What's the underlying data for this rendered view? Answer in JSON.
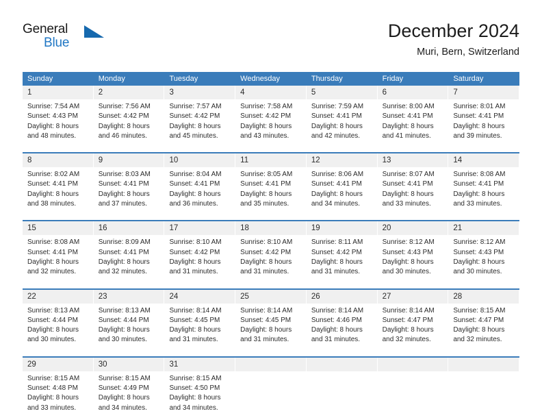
{
  "logo": {
    "primary_text": "General",
    "secondary_text": "Blue",
    "primary_color": "#1a1a1a",
    "secondary_color": "#2077c4",
    "triangle_color": "#1669ae"
  },
  "header": {
    "title": "December 2024",
    "subtitle": "Muri, Bern, Switzerland"
  },
  "theme": {
    "header_row_bg": "#3a7cba",
    "day_number_bg": "#f0f0f0",
    "text_color": "#2b2b2b"
  },
  "calendar": {
    "weekdays": [
      "Sunday",
      "Monday",
      "Tuesday",
      "Wednesday",
      "Thursday",
      "Friday",
      "Saturday"
    ],
    "weeks": [
      [
        {
          "day": "1",
          "sunrise": "Sunrise: 7:54 AM",
          "sunset": "Sunset: 4:43 PM",
          "daylight1": "Daylight: 8 hours",
          "daylight2": "and 48 minutes."
        },
        {
          "day": "2",
          "sunrise": "Sunrise: 7:56 AM",
          "sunset": "Sunset: 4:42 PM",
          "daylight1": "Daylight: 8 hours",
          "daylight2": "and 46 minutes."
        },
        {
          "day": "3",
          "sunrise": "Sunrise: 7:57 AM",
          "sunset": "Sunset: 4:42 PM",
          "daylight1": "Daylight: 8 hours",
          "daylight2": "and 45 minutes."
        },
        {
          "day": "4",
          "sunrise": "Sunrise: 7:58 AM",
          "sunset": "Sunset: 4:42 PM",
          "daylight1": "Daylight: 8 hours",
          "daylight2": "and 43 minutes."
        },
        {
          "day": "5",
          "sunrise": "Sunrise: 7:59 AM",
          "sunset": "Sunset: 4:41 PM",
          "daylight1": "Daylight: 8 hours",
          "daylight2": "and 42 minutes."
        },
        {
          "day": "6",
          "sunrise": "Sunrise: 8:00 AM",
          "sunset": "Sunset: 4:41 PM",
          "daylight1": "Daylight: 8 hours",
          "daylight2": "and 41 minutes."
        },
        {
          "day": "7",
          "sunrise": "Sunrise: 8:01 AM",
          "sunset": "Sunset: 4:41 PM",
          "daylight1": "Daylight: 8 hours",
          "daylight2": "and 39 minutes."
        }
      ],
      [
        {
          "day": "8",
          "sunrise": "Sunrise: 8:02 AM",
          "sunset": "Sunset: 4:41 PM",
          "daylight1": "Daylight: 8 hours",
          "daylight2": "and 38 minutes."
        },
        {
          "day": "9",
          "sunrise": "Sunrise: 8:03 AM",
          "sunset": "Sunset: 4:41 PM",
          "daylight1": "Daylight: 8 hours",
          "daylight2": "and 37 minutes."
        },
        {
          "day": "10",
          "sunrise": "Sunrise: 8:04 AM",
          "sunset": "Sunset: 4:41 PM",
          "daylight1": "Daylight: 8 hours",
          "daylight2": "and 36 minutes."
        },
        {
          "day": "11",
          "sunrise": "Sunrise: 8:05 AM",
          "sunset": "Sunset: 4:41 PM",
          "daylight1": "Daylight: 8 hours",
          "daylight2": "and 35 minutes."
        },
        {
          "day": "12",
          "sunrise": "Sunrise: 8:06 AM",
          "sunset": "Sunset: 4:41 PM",
          "daylight1": "Daylight: 8 hours",
          "daylight2": "and 34 minutes."
        },
        {
          "day": "13",
          "sunrise": "Sunrise: 8:07 AM",
          "sunset": "Sunset: 4:41 PM",
          "daylight1": "Daylight: 8 hours",
          "daylight2": "and 33 minutes."
        },
        {
          "day": "14",
          "sunrise": "Sunrise: 8:08 AM",
          "sunset": "Sunset: 4:41 PM",
          "daylight1": "Daylight: 8 hours",
          "daylight2": "and 33 minutes."
        }
      ],
      [
        {
          "day": "15",
          "sunrise": "Sunrise: 8:08 AM",
          "sunset": "Sunset: 4:41 PM",
          "daylight1": "Daylight: 8 hours",
          "daylight2": "and 32 minutes."
        },
        {
          "day": "16",
          "sunrise": "Sunrise: 8:09 AM",
          "sunset": "Sunset: 4:41 PM",
          "daylight1": "Daylight: 8 hours",
          "daylight2": "and 32 minutes."
        },
        {
          "day": "17",
          "sunrise": "Sunrise: 8:10 AM",
          "sunset": "Sunset: 4:42 PM",
          "daylight1": "Daylight: 8 hours",
          "daylight2": "and 31 minutes."
        },
        {
          "day": "18",
          "sunrise": "Sunrise: 8:10 AM",
          "sunset": "Sunset: 4:42 PM",
          "daylight1": "Daylight: 8 hours",
          "daylight2": "and 31 minutes."
        },
        {
          "day": "19",
          "sunrise": "Sunrise: 8:11 AM",
          "sunset": "Sunset: 4:42 PM",
          "daylight1": "Daylight: 8 hours",
          "daylight2": "and 31 minutes."
        },
        {
          "day": "20",
          "sunrise": "Sunrise: 8:12 AM",
          "sunset": "Sunset: 4:43 PM",
          "daylight1": "Daylight: 8 hours",
          "daylight2": "and 30 minutes."
        },
        {
          "day": "21",
          "sunrise": "Sunrise: 8:12 AM",
          "sunset": "Sunset: 4:43 PM",
          "daylight1": "Daylight: 8 hours",
          "daylight2": "and 30 minutes."
        }
      ],
      [
        {
          "day": "22",
          "sunrise": "Sunrise: 8:13 AM",
          "sunset": "Sunset: 4:44 PM",
          "daylight1": "Daylight: 8 hours",
          "daylight2": "and 30 minutes."
        },
        {
          "day": "23",
          "sunrise": "Sunrise: 8:13 AM",
          "sunset": "Sunset: 4:44 PM",
          "daylight1": "Daylight: 8 hours",
          "daylight2": "and 30 minutes."
        },
        {
          "day": "24",
          "sunrise": "Sunrise: 8:14 AM",
          "sunset": "Sunset: 4:45 PM",
          "daylight1": "Daylight: 8 hours",
          "daylight2": "and 31 minutes."
        },
        {
          "day": "25",
          "sunrise": "Sunrise: 8:14 AM",
          "sunset": "Sunset: 4:45 PM",
          "daylight1": "Daylight: 8 hours",
          "daylight2": "and 31 minutes."
        },
        {
          "day": "26",
          "sunrise": "Sunrise: 8:14 AM",
          "sunset": "Sunset: 4:46 PM",
          "daylight1": "Daylight: 8 hours",
          "daylight2": "and 31 minutes."
        },
        {
          "day": "27",
          "sunrise": "Sunrise: 8:14 AM",
          "sunset": "Sunset: 4:47 PM",
          "daylight1": "Daylight: 8 hours",
          "daylight2": "and 32 minutes."
        },
        {
          "day": "28",
          "sunrise": "Sunrise: 8:15 AM",
          "sunset": "Sunset: 4:47 PM",
          "daylight1": "Daylight: 8 hours",
          "daylight2": "and 32 minutes."
        }
      ],
      [
        {
          "day": "29",
          "sunrise": "Sunrise: 8:15 AM",
          "sunset": "Sunset: 4:48 PM",
          "daylight1": "Daylight: 8 hours",
          "daylight2": "and 33 minutes."
        },
        {
          "day": "30",
          "sunrise": "Sunrise: 8:15 AM",
          "sunset": "Sunset: 4:49 PM",
          "daylight1": "Daylight: 8 hours",
          "daylight2": "and 34 minutes."
        },
        {
          "day": "31",
          "sunrise": "Sunrise: 8:15 AM",
          "sunset": "Sunset: 4:50 PM",
          "daylight1": "Daylight: 8 hours",
          "daylight2": "and 34 minutes."
        },
        {
          "day": "",
          "sunrise": "",
          "sunset": "",
          "daylight1": "",
          "daylight2": ""
        },
        {
          "day": "",
          "sunrise": "",
          "sunset": "",
          "daylight1": "",
          "daylight2": ""
        },
        {
          "day": "",
          "sunrise": "",
          "sunset": "",
          "daylight1": "",
          "daylight2": ""
        },
        {
          "day": "",
          "sunrise": "",
          "sunset": "",
          "daylight1": "",
          "daylight2": ""
        }
      ]
    ]
  }
}
